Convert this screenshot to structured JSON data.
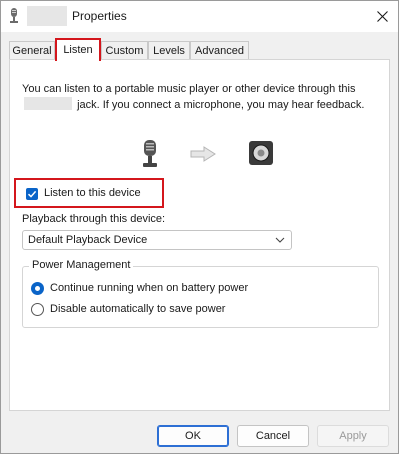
{
  "window": {
    "title": "Properties",
    "close_icon": "close-icon",
    "app_icon": "microphone-icon"
  },
  "tabs": [
    {
      "label": "General",
      "active": false
    },
    {
      "label": "Listen",
      "active": true
    },
    {
      "label": "Custom",
      "active": false
    },
    {
      "label": "Levels",
      "active": false
    },
    {
      "label": "Advanced",
      "active": false
    }
  ],
  "listen": {
    "description_part1": "You can listen to a portable music player or other device through this",
    "description_part2": "jack.  If you connect a microphone, you may hear feedback.",
    "icons": [
      "microphone-icon",
      "arrow-right-icon",
      "speaker-icon"
    ],
    "listen_checkbox_label": "Listen to this device",
    "listen_checked": true,
    "playback_label": "Playback through this device:",
    "playback_selected": "Default Playback Device",
    "power_group_title": "Power Management",
    "power_option_continue": "Continue running when on battery power",
    "power_option_disable": "Disable automatically to save power",
    "power_selected": "continue"
  },
  "buttons": {
    "ok": "OK",
    "cancel": "Cancel",
    "apply": "Apply"
  },
  "colors": {
    "accent": "#0a64c8",
    "highlight": "#d4161c"
  }
}
